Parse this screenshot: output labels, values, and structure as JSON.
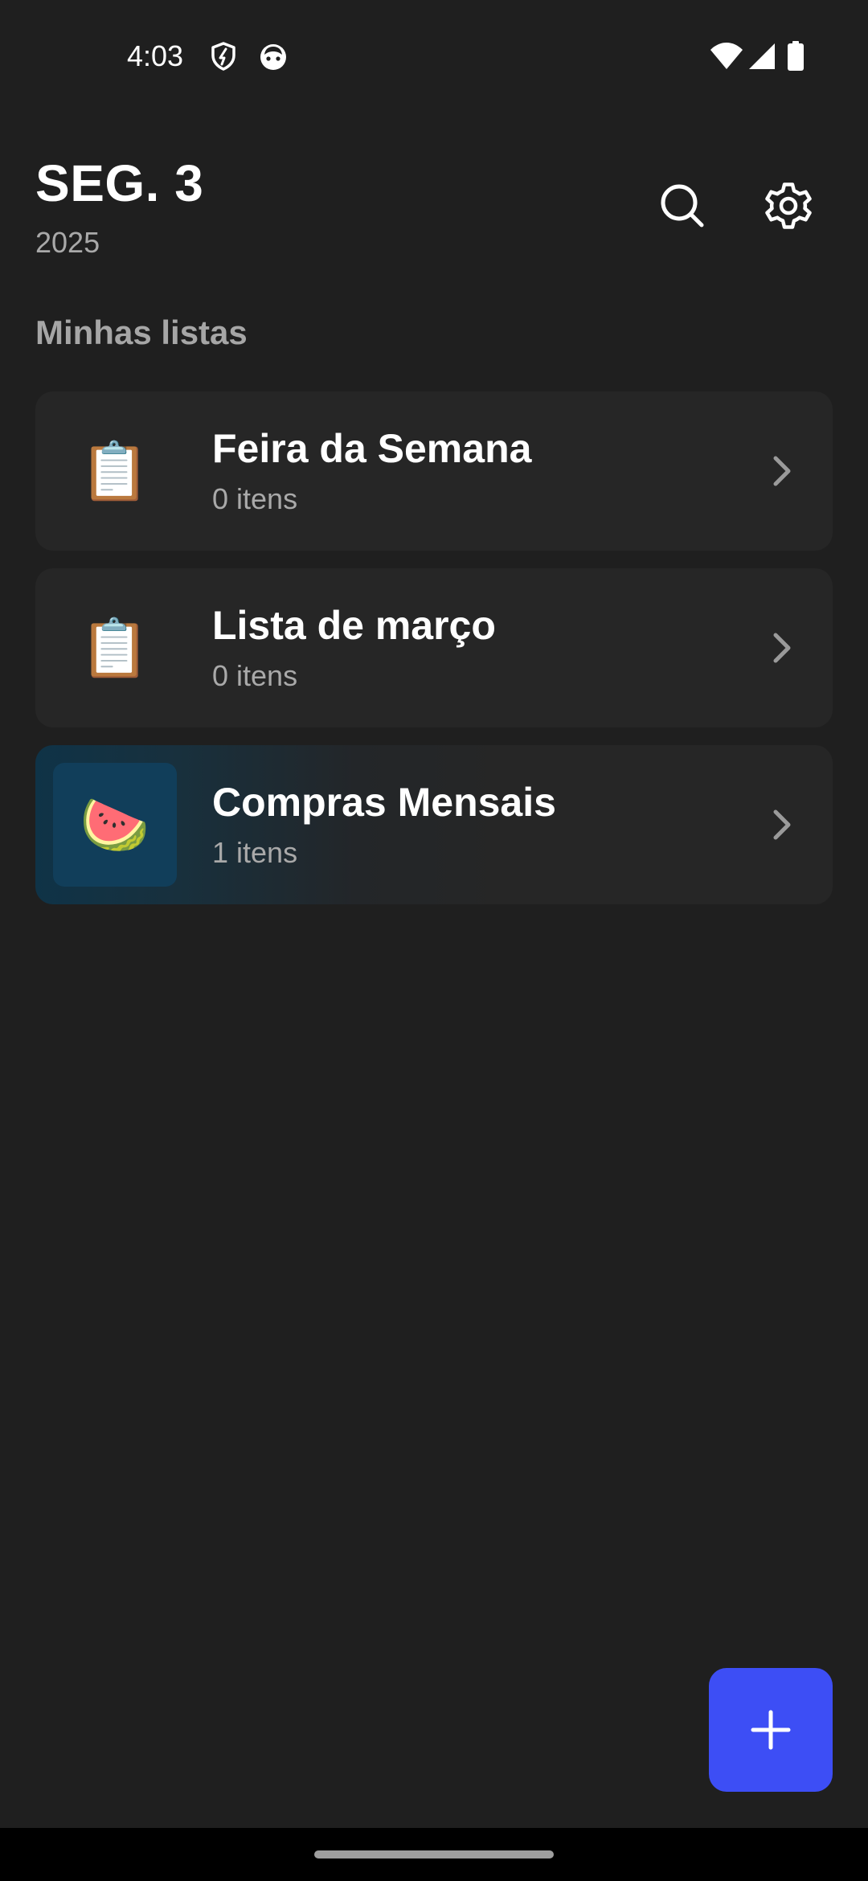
{
  "status_bar": {
    "time": "4:03",
    "icons": [
      "shield-icon",
      "cat-face-icon",
      "wifi-icon",
      "signal-icon",
      "battery-icon"
    ]
  },
  "header": {
    "title": "SEG. 3",
    "year": "2025",
    "search_icon": "search-icon",
    "settings_icon": "gear-icon"
  },
  "section": {
    "title": "Minhas listas"
  },
  "lists": [
    {
      "emoji": "📋",
      "title": "Feira da Semana",
      "count": "0 itens"
    },
    {
      "emoji": "📋",
      "title": "Lista de março",
      "count": "0 itens"
    },
    {
      "emoji": "🍉",
      "title": "Compras Mensais",
      "count": "1 itens"
    }
  ],
  "fab": {
    "icon": "plus-icon"
  },
  "colors": {
    "background": "#1f1f1f",
    "card": "#262626",
    "accent": "#3d4ef5",
    "highlight_icon_bg": "#113e5a",
    "secondary_text": "#a9a9a9"
  }
}
